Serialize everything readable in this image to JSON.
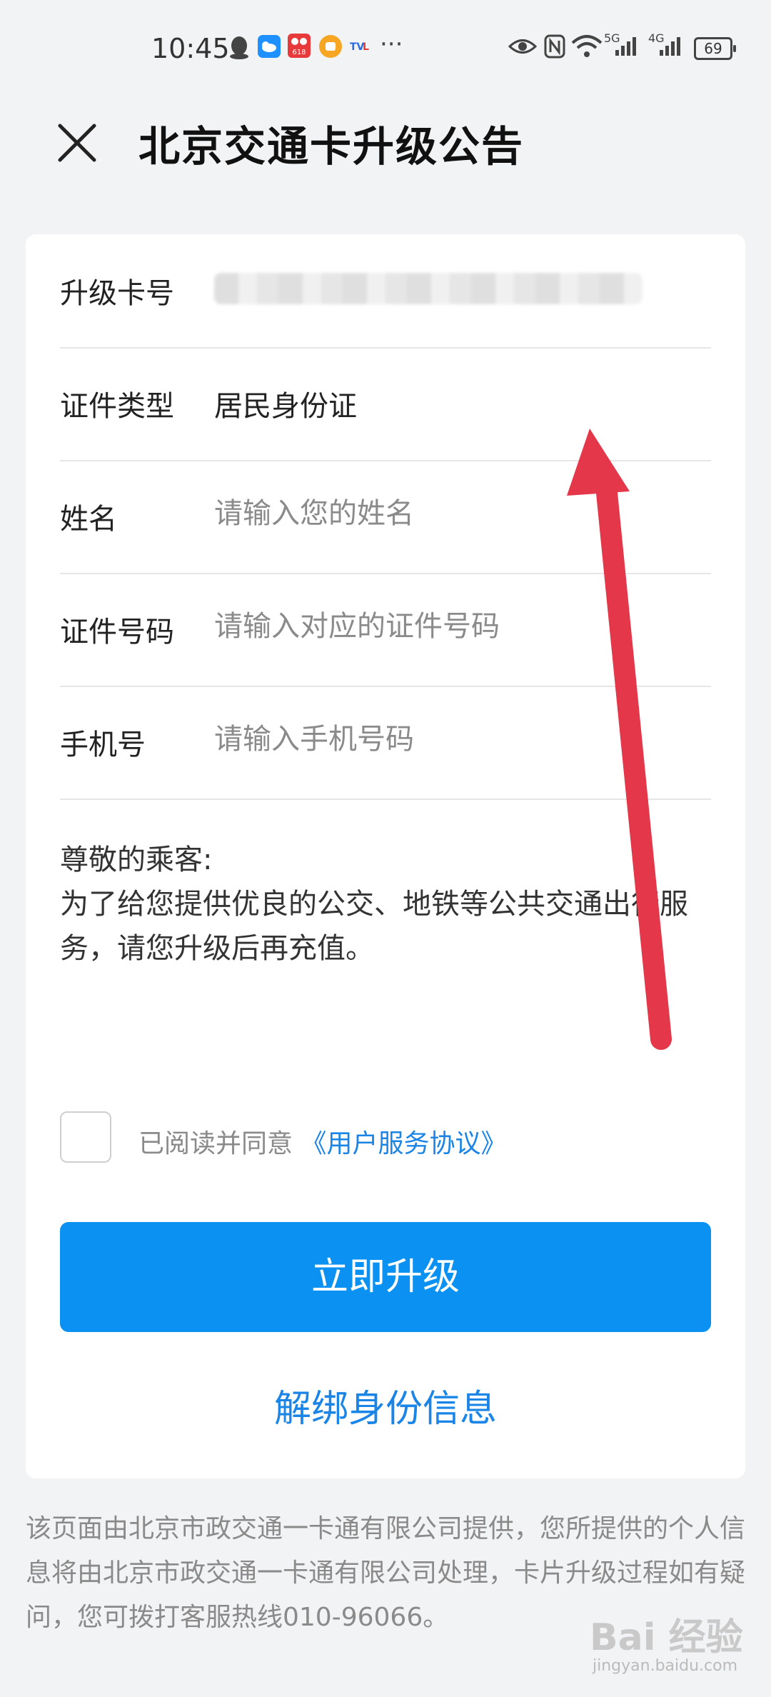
{
  "status_bar": {
    "time": "10:45",
    "battery": "69",
    "network_1": "5G",
    "network_2": "4G",
    "icons": [
      "qq-icon",
      "weather-icon",
      "shopping-618-icon",
      "app-orange-icon",
      "tv-app-icon",
      "more-dots-icon",
      "eye-icon",
      "nfc-icon",
      "wifi-icon",
      "signal-icon",
      "battery-icon"
    ]
  },
  "header": {
    "title": "北京交通卡升级公告",
    "close_icon": "close-icon"
  },
  "form": {
    "card_number": {
      "label": "升级卡号"
    },
    "id_type": {
      "label": "证件类型",
      "value": "居民身份证"
    },
    "name": {
      "label": "姓名",
      "placeholder": "请输入您的姓名"
    },
    "id_number": {
      "label": "证件号码",
      "placeholder": "请输入对应的证件号码"
    },
    "phone": {
      "label": "手机号",
      "placeholder": "请输入手机号码"
    }
  },
  "notice": {
    "greeting": "尊敬的乘客:",
    "body": "为了给您提供优良的公交、地铁等公共交通出行服务，请您升级后再充值。"
  },
  "agreement": {
    "text": "已阅读并同意 ",
    "link": "《用户服务协议》"
  },
  "actions": {
    "upgrade": "立即升级",
    "unbind": "解绑身份信息"
  },
  "footer": {
    "text": "该页面由北京市政交通一卡通有限公司提供，您所提供的个人信息将由北京市政交通一卡通有限公司处理，卡片升级过程如有疑问，您可拨打客服热线010-96066。"
  },
  "watermark": {
    "text": "Bai 经验",
    "sub": "jingyan.baidu.com"
  },
  "colors": {
    "primary": "#0a91f2",
    "link": "#1a85e6",
    "annotation_arrow": "#e5374a",
    "background": "#f2f3f5"
  }
}
